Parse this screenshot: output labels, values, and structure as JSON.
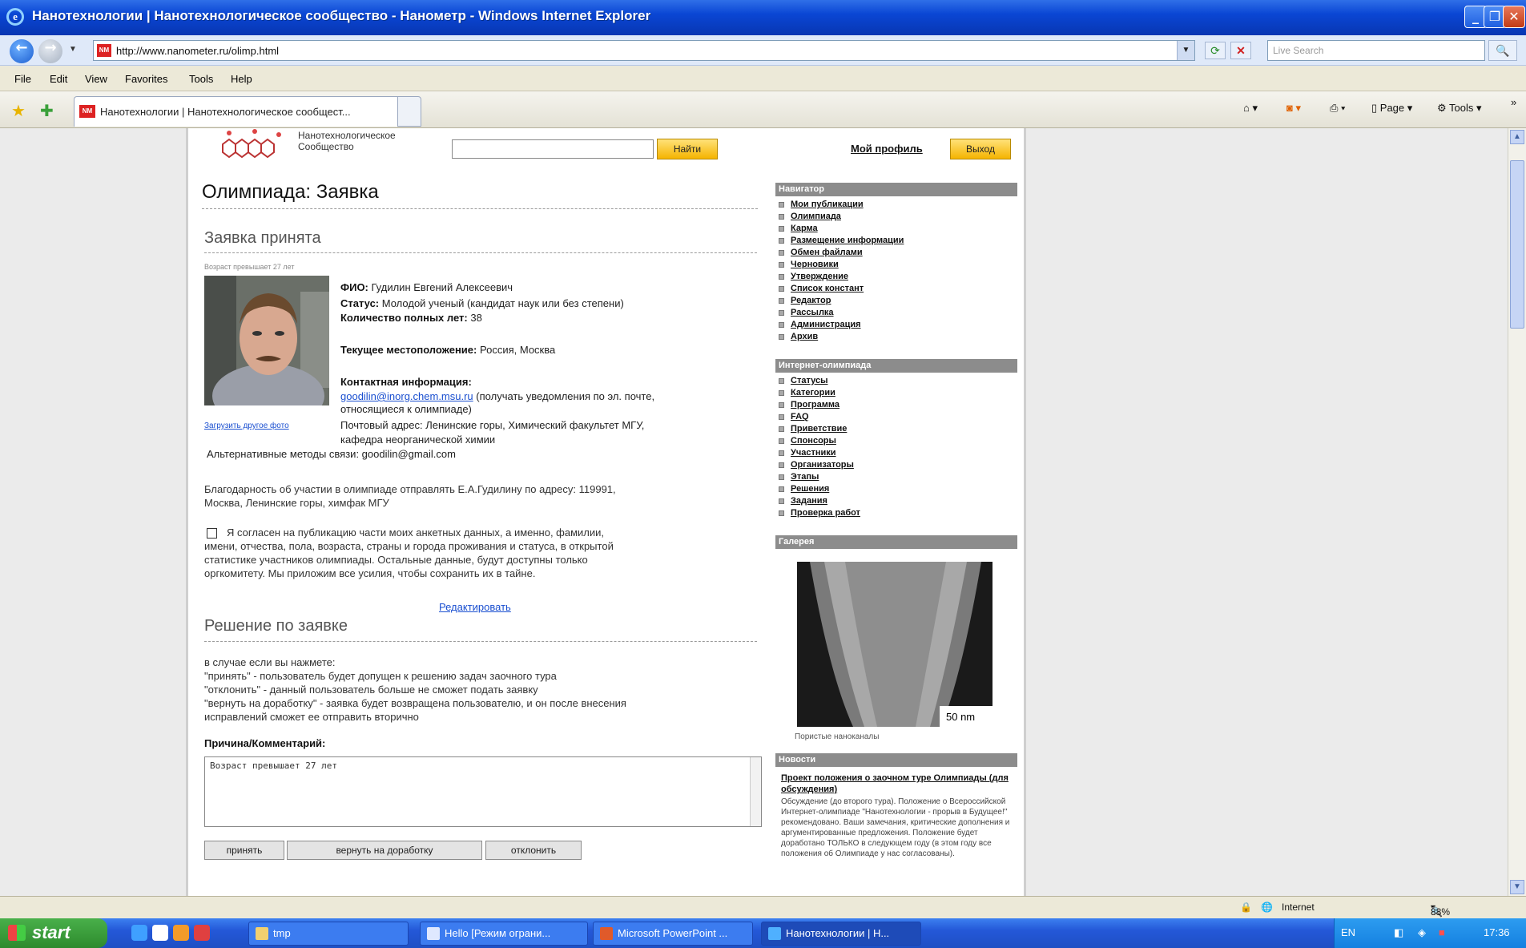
{
  "window": {
    "title": "Нанотехнологии | Нанотехнологическое сообщество - Нанометр - Windows Internet Explorer"
  },
  "address": {
    "url": "http://www.nanometer.ru/olimp.html",
    "search_placeholder": "Live Search"
  },
  "menu": [
    "File",
    "Edit",
    "View",
    "Favorites",
    "Tools",
    "Help"
  ],
  "tab": {
    "title": "Нанотехнологии | Нанотехнологическое сообщест..."
  },
  "command_bar": {
    "page": "Page",
    "tools": "Tools"
  },
  "site": {
    "logo_text_line1": "Нанотехнологическое",
    "logo_text_line2": "Сообщество",
    "search_button": "Найти",
    "profile_link": "Мой профиль",
    "logout_button": "Выход"
  },
  "page": {
    "title": "Олимпиада: Заявка",
    "status_heading": "Заявка принята",
    "age_note": "Возраст превышает 27 лет",
    "photo_link": "Загрузить другое фото",
    "fio_label": "ФИО:",
    "fio_value": "Гудилин Евгений Алексеевич",
    "status_label": "Статус:",
    "status_value": "Молодой ученый (кандидат наук или без степени)",
    "years_label": "Количество полных лет:",
    "years_value": "38",
    "location_label": "Текущее местоположение:",
    "location_value": "Россия, Москва",
    "contact_label": "Контактная информация:",
    "email": "goodilin@inorg.chem.msu.ru",
    "email_note_1": "(получать уведомления по эл. почте,",
    "email_note_2": "относящиеся к олимпиаде)",
    "postal_1": "Почтовый адрес: Ленинские горы, Химический факультет МГУ,",
    "postal_2": "кафедра неорганической химии",
    "alt_contact": "Альтернативные методы связи: goodilin@gmail.com",
    "thanks_1": "Благодарность об участии в олимпиаде отправлять Е.А.Гудилину по адресу: 119991,",
    "thanks_2": "Москва, Ленинские горы, химфак МГУ",
    "consent_1": "Я согласен на публикацию части моих анкетных данных, а именно, фамилии,",
    "consent_2": "имени, отчества, пола, возраста, страны и города проживания и статуса, в открытой",
    "consent_3": "статистике участников олимпиады. Остальные данные, будут доступны только",
    "consent_4": "оргкомитету. Мы приложим все усилия, чтобы сохранить их в тайне.",
    "edit_link": "Редактировать",
    "decision_heading": "Решение по заявке",
    "decision_1": "в случае если вы нажмете:",
    "decision_2": "\"принять\" - пользователь будет допущен к решению задач заочного тура",
    "decision_3": "\"отклонить\" - данный пользователь больше не сможет подать заявку",
    "decision_4": "\"вернуть на доработку\" - заявка будет возвращена пользователю, и он после внесения",
    "decision_5": "исправлений сможет ее отправить вторично",
    "comment_label": "Причина/Комментарий:",
    "comment_value": "Возраст превышает 27 лет",
    "btn_accept": "принять",
    "btn_return": "вернуть на доработку",
    "btn_reject": "отклонить"
  },
  "sidebar": {
    "nav_heading": "Навигатор",
    "nav_items": [
      "Мои публикации",
      "Олимпиада",
      "Карма",
      "Размещение информации",
      "Обмен файлами",
      "Черновики",
      "Утверждение",
      "Список констант",
      "Редактор",
      "Рассылка",
      "Администрация",
      "Архив"
    ],
    "olymp_heading": "Интернет-олимпиада",
    "olymp_items": [
      "Статусы",
      "Категории",
      "Программа",
      "FAQ",
      "Приветствие",
      "Спонсоры",
      "Участники",
      "Организаторы",
      "Этапы",
      "Решения",
      "Задания",
      "Проверка работ"
    ],
    "gallery_heading": "Галерея",
    "gallery_scale": "50 nm",
    "gallery_caption": "Пористые наноканалы",
    "news_heading": "Новости",
    "news_title": "Проект положения о заочном туре Олимпиады (для обсуждения)",
    "news_body": "Обсуждение (до второго тура). Положение о Всероссийской Интернет-олимпиаде \"Нанотехнологии - прорыв в Будущее!\" рекомендовано. Ваши замечания, критические дополнения и аргументированные предложения. Положение будет доработано ТОЛЬКО в следующем году (в этом году все положения об Олимпиаде у нас согласованы)."
  },
  "statusbar": {
    "zone": "Internet",
    "zoom": "88%"
  },
  "taskbar": {
    "start": "start",
    "tasks": [
      "tmp",
      "Hello [Режим ограни...",
      "Microsoft PowerPoint ...",
      "Нанотехнологии | Н..."
    ],
    "lang": "EN",
    "clock": "17:36"
  },
  "colors": {
    "title_blue": "#0a46d4",
    "link_blue": "#1a4fd0",
    "yellow_button": "#f5b400",
    "sidebar_head": "#8c8c8c"
  }
}
